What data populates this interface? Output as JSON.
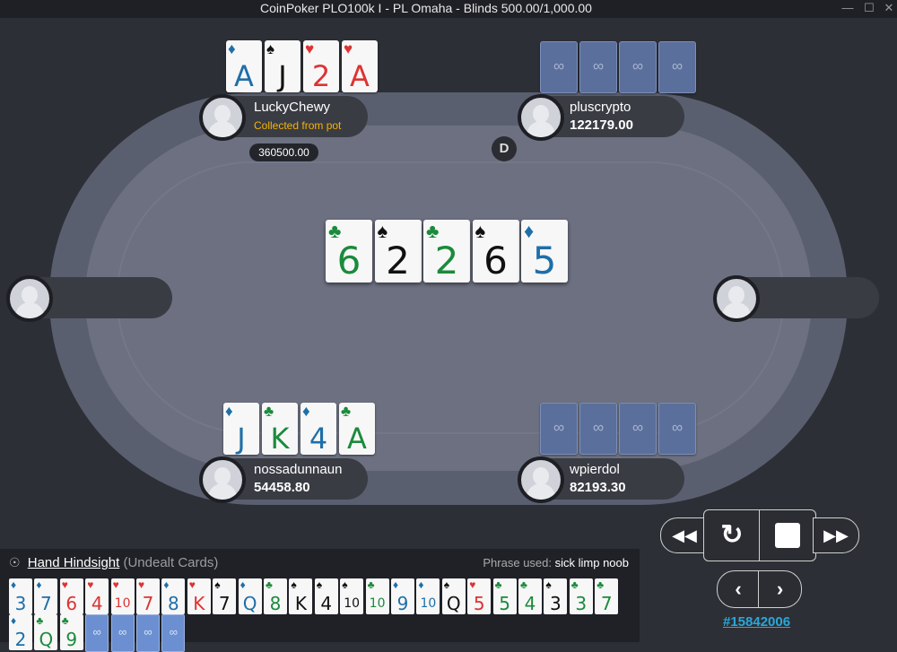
{
  "window": {
    "title": "CoinPoker PLO100k I - PL Omaha - Blinds 500.00/1,000.00"
  },
  "players": {
    "top_left": {
      "name": "LuckyChewy",
      "status": "Collected from pot",
      "chips": "360500.00",
      "cards": [
        {
          "rank": "A",
          "suit": "diamond"
        },
        {
          "rank": "J",
          "suit": "spade"
        },
        {
          "rank": "2",
          "suit": "heart"
        },
        {
          "rank": "A",
          "suit": "heart"
        }
      ]
    },
    "top_right": {
      "name": "pluscrypto",
      "stack": "122179.00"
    },
    "bottom_left": {
      "name": "nossadunnaun",
      "stack": "54458.80",
      "cards": [
        {
          "rank": "J",
          "suit": "diamond"
        },
        {
          "rank": "K",
          "suit": "club"
        },
        {
          "rank": "4",
          "suit": "diamond"
        },
        {
          "rank": "A",
          "suit": "club"
        }
      ]
    },
    "bottom_right": {
      "name": "wpierdol",
      "stack": "82193.30"
    }
  },
  "dealer_button": "D",
  "board": [
    {
      "rank": "6",
      "suit": "club"
    },
    {
      "rank": "2",
      "suit": "spade"
    },
    {
      "rank": "2",
      "suit": "club"
    },
    {
      "rank": "6",
      "suit": "spade"
    },
    {
      "rank": "5",
      "suit": "diamond"
    }
  ],
  "hindsight": {
    "title": "Hand Hindsight",
    "subtitle": "(Undealt Cards)",
    "phrase_label": "Phrase used:",
    "phrase": "sick limp noob",
    "cards": [
      {
        "rank": "3",
        "suit": "diamond"
      },
      {
        "rank": "7",
        "suit": "diamond"
      },
      {
        "rank": "6",
        "suit": "heart"
      },
      {
        "rank": "4",
        "suit": "heart"
      },
      {
        "rank": "10",
        "suit": "heart"
      },
      {
        "rank": "7",
        "suit": "heart"
      },
      {
        "rank": "8",
        "suit": "diamond"
      },
      {
        "rank": "K",
        "suit": "heart"
      },
      {
        "rank": "7",
        "suit": "spade"
      },
      {
        "rank": "Q",
        "suit": "diamond"
      },
      {
        "rank": "8",
        "suit": "club"
      },
      {
        "rank": "K",
        "suit": "spade"
      },
      {
        "rank": "4",
        "suit": "spade"
      },
      {
        "rank": "10",
        "suit": "spade"
      },
      {
        "rank": "10",
        "suit": "club"
      },
      {
        "rank": "9",
        "suit": "diamond"
      },
      {
        "rank": "10",
        "suit": "diamond"
      },
      {
        "rank": "Q",
        "suit": "spade"
      },
      {
        "rank": "5",
        "suit": "heart"
      },
      {
        "rank": "5",
        "suit": "club"
      },
      {
        "rank": "4",
        "suit": "club"
      },
      {
        "rank": "3",
        "suit": "spade"
      },
      {
        "rank": "3",
        "suit": "club"
      },
      {
        "rank": "7",
        "suit": "club"
      },
      {
        "rank": "2",
        "suit": "diamond"
      },
      {
        "rank": "Q",
        "suit": "club"
      },
      {
        "rank": "9",
        "suit": "club"
      }
    ],
    "hidden_count": 4
  },
  "controls": {
    "hand_id": "#15842006"
  }
}
